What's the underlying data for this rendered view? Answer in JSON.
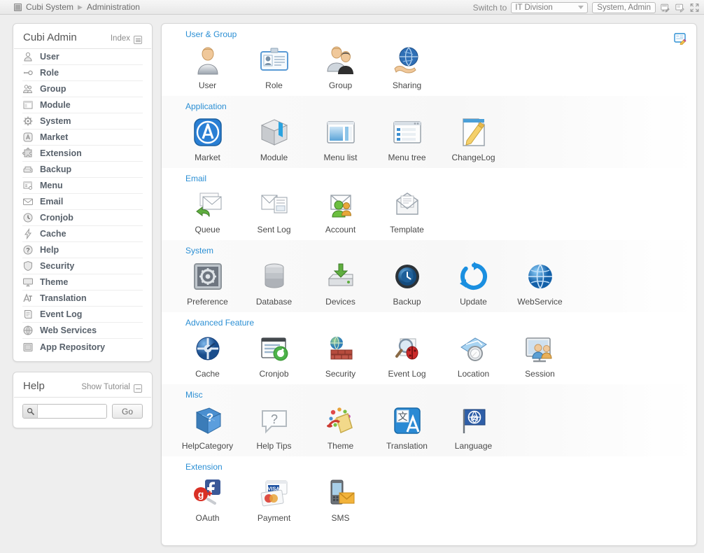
{
  "topbar": {
    "breadcrumb": [
      "Cubi System",
      "Administration"
    ],
    "separator": "▶",
    "switch_label": "Switch to",
    "division": "IT Division",
    "user": "System, Admin",
    "icons": [
      "screen-edit-icon",
      "note-edit-icon",
      "fullscreen-icon"
    ]
  },
  "sidebar": {
    "title": "Cubi Admin",
    "index_label": "Index",
    "items": [
      {
        "label": "User",
        "icon": "user-icon"
      },
      {
        "label": "Role",
        "icon": "key-icon"
      },
      {
        "label": "Group",
        "icon": "group-icon"
      },
      {
        "label": "Module",
        "icon": "module-icon"
      },
      {
        "label": "System",
        "icon": "gear-icon"
      },
      {
        "label": "Market",
        "icon": "market-icon"
      },
      {
        "label": "Extension",
        "icon": "puzzle-icon"
      },
      {
        "label": "Backup",
        "icon": "backup-icon"
      },
      {
        "label": "Menu",
        "icon": "menu-icon"
      },
      {
        "label": "Email",
        "icon": "email-icon"
      },
      {
        "label": "Cronjob",
        "icon": "clock-icon"
      },
      {
        "label": "Cache",
        "icon": "lightning-icon"
      },
      {
        "label": "Help",
        "icon": "question-icon"
      },
      {
        "label": "Security",
        "icon": "shield-icon"
      },
      {
        "label": "Theme",
        "icon": "monitor-icon"
      },
      {
        "label": "Translation",
        "icon": "translation-icon"
      },
      {
        "label": "Event Log",
        "icon": "scroll-icon"
      },
      {
        "label": "Web Services",
        "icon": "globe-icon"
      },
      {
        "label": "App Repository",
        "icon": "repository-icon"
      }
    ],
    "help": {
      "title": "Help",
      "tutorial_label": "Show Tutorial",
      "search_value": "",
      "search_placeholder": "",
      "go_label": "Go"
    }
  },
  "content": {
    "edit_icon": "customize-icon",
    "sections": [
      {
        "title": "User & Group",
        "shaded": false,
        "tiles": [
          {
            "label": "User",
            "icon": "user-avatar-icon"
          },
          {
            "label": "Role",
            "icon": "id-card-icon"
          },
          {
            "label": "Group",
            "icon": "two-people-icon"
          },
          {
            "label": "Sharing",
            "icon": "globe-hand-icon"
          }
        ]
      },
      {
        "title": "Application",
        "shaded": true,
        "tiles": [
          {
            "label": "Market",
            "icon": "app-market-icon"
          },
          {
            "label": "Module",
            "icon": "box-icon"
          },
          {
            "label": "Menu list",
            "icon": "window-list-icon"
          },
          {
            "label": "Menu tree",
            "icon": "window-tree-icon"
          },
          {
            "label": "ChangeLog",
            "icon": "pencil-page-icon"
          }
        ]
      },
      {
        "title": "Email",
        "shaded": false,
        "tiles": [
          {
            "label": "Queue",
            "icon": "mail-queue-icon"
          },
          {
            "label": "Sent Log",
            "icon": "mail-log-icon"
          },
          {
            "label": "Account",
            "icon": "mail-account-icon"
          },
          {
            "label": "Template",
            "icon": "mail-template-icon"
          }
        ]
      },
      {
        "title": "System",
        "shaded": true,
        "tiles": [
          {
            "label": "Preference",
            "icon": "preference-gear-icon"
          },
          {
            "label": "Database",
            "icon": "database-icon"
          },
          {
            "label": "Devices",
            "icon": "device-download-icon"
          },
          {
            "label": "Backup",
            "icon": "backup-clock-icon"
          },
          {
            "label": "Update",
            "icon": "refresh-icon"
          },
          {
            "label": "WebService",
            "icon": "blue-globe-icon"
          }
        ]
      },
      {
        "title": "Advanced Feature",
        "shaded": false,
        "tiles": [
          {
            "label": "Cache",
            "icon": "cache-clock-icon"
          },
          {
            "label": "Cronjob",
            "icon": "cronjob-window-icon"
          },
          {
            "label": "Security",
            "icon": "firewall-icon"
          },
          {
            "label": "Event Log",
            "icon": "bug-magnifier-icon"
          },
          {
            "label": "Location",
            "icon": "compass-map-icon"
          },
          {
            "label": "Session",
            "icon": "session-users-icon"
          }
        ]
      },
      {
        "title": "Misc",
        "shaded": true,
        "tiles": [
          {
            "label": "HelpCategory",
            "icon": "help-category-icon"
          },
          {
            "label": "Help Tips",
            "icon": "speech-question-icon"
          },
          {
            "label": "Theme",
            "icon": "paint-bucket-icon"
          },
          {
            "label": "Translation",
            "icon": "translate-a-icon"
          },
          {
            "label": "Language",
            "icon": "language-flag-icon"
          }
        ]
      },
      {
        "title": "Extension",
        "shaded": false,
        "tiles": [
          {
            "label": "OAuth",
            "icon": "oauth-social-icon"
          },
          {
            "label": "Payment",
            "icon": "credit-card-icon"
          },
          {
            "label": "SMS",
            "icon": "sms-phone-icon"
          }
        ]
      }
    ]
  },
  "colors": {
    "section_title": "#2b8fd4",
    "nav_label": "#58616b",
    "page_background": "#eeeeee"
  }
}
